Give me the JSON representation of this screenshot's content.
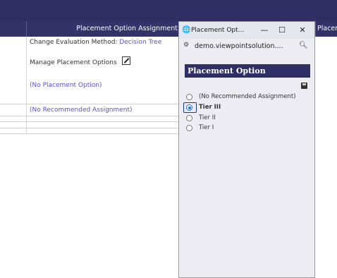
{
  "table": {
    "header_title": "Placement Option Assignment",
    "header_right_partial": "Placen",
    "change_eval_label": "Change Evaluation Method:",
    "change_eval_link": "Decision Tree",
    "manage_placement": "Manage Placement Options",
    "no_placement_option": "(No Placement Option)",
    "no_recommended_assignment": "(No Recommended Assignment)"
  },
  "popup": {
    "window_title": "Placement Opt...",
    "minimize": "—",
    "maximize": "☐",
    "close": "✕",
    "address": "demo.viewpointsolution....",
    "header": "Placement Option",
    "options": [
      {
        "label": "(No Recommended Assignment)",
        "checked": false,
        "bold": false
      },
      {
        "label": "Tier III",
        "checked": true,
        "bold": true
      },
      {
        "label": "Tier II",
        "checked": false,
        "bold": false
      },
      {
        "label": "Tier I",
        "checked": false,
        "bold": false
      }
    ]
  },
  "colors": {
    "header_bg": "#33336a",
    "link": "#5a4fd6",
    "radio_selected": "#1f6fd6"
  },
  "icons": [
    "pencil-edit-icon",
    "globe-icon",
    "site-settings-icon",
    "zoom-icon",
    "save-disk-icon"
  ]
}
